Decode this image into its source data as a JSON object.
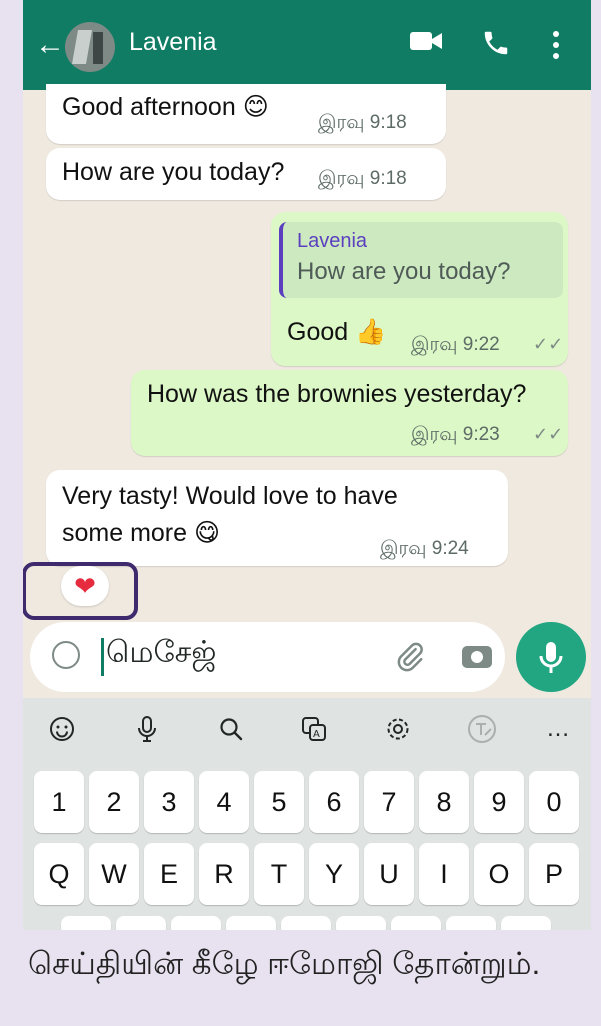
{
  "header": {
    "back_icon": "←",
    "contact_name": "Lavenia"
  },
  "messages": [
    {
      "text": "Good afternoon 😊",
      "time": "இரவு 9:18"
    },
    {
      "text": "How are you today?",
      "time": "இரவு 9:18"
    },
    {
      "quote_name": "Lavenia",
      "quote_text": "How are you today?",
      "text": "Good 👍",
      "time": "இரவு 9:22",
      "checks": "✓✓"
    },
    {
      "text": "How was the brownies yesterday?",
      "time": "இரவு 9:23",
      "checks": "✓✓"
    },
    {
      "line1": "Very tasty! Would love to have",
      "line2": "some more 😋",
      "time": "இரவு 9:24"
    }
  ],
  "reaction": "❤",
  "composer": {
    "placeholder": "மெசேஜ்"
  },
  "keyboard": {
    "toolbar_more": "…",
    "numbers": [
      "1",
      "2",
      "3",
      "4",
      "5",
      "6",
      "7",
      "8",
      "9",
      "0"
    ],
    "row_q": [
      "Q",
      "W",
      "E",
      "R",
      "T",
      "Y",
      "U",
      "I",
      "O",
      "P"
    ]
  },
  "caption": "செய்தியின் கீழே ஈமோஜி தோன்றும்.",
  "colors": {
    "header": "#0f7c63",
    "outgoing": "#dcf8c6",
    "accent": "#21a681",
    "highlight": "#3e2a6d"
  }
}
